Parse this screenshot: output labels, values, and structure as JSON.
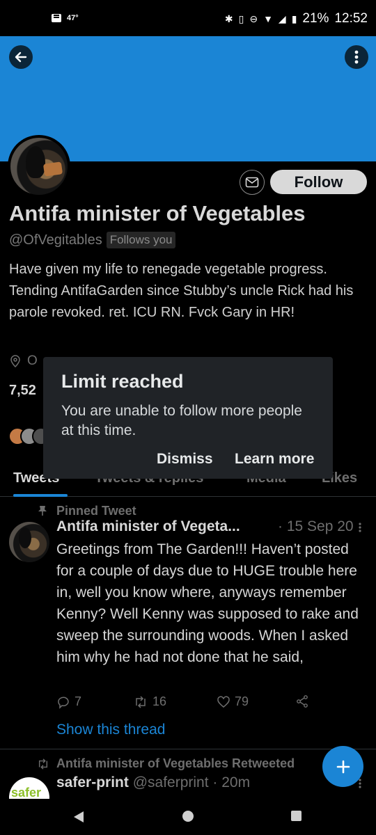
{
  "status_bar": {
    "temperature": "47°",
    "battery": "21%",
    "time": "12:52"
  },
  "profile": {
    "display_name": "Antifa minister of Vegetables",
    "handle": "@OfVegitables",
    "follows_you": "Follows you",
    "bio": "Have given my life to renegade vegetable progress. Tending AntifaGarden since Stubby’s uncle Rick had his parole revoked. ret. ICU RN. Fvck Gary in HR!",
    "meta_visible": "O",
    "count_visible": "7,52",
    "follow_label": "Follow"
  },
  "dialog": {
    "title": "Limit reached",
    "message": "You are unable to follow more people at this time.",
    "dismiss": "Dismiss",
    "learn_more": "Learn more"
  },
  "tabs": [
    {
      "label": "Tweets",
      "active": true
    },
    {
      "label": "Tweets & replies",
      "active": false
    },
    {
      "label": "Media",
      "active": false
    },
    {
      "label": "Likes",
      "active": false
    }
  ],
  "pinned_tweet": {
    "label": "Pinned Tweet",
    "author": "Antifa minister of Vegeta...",
    "date": "· 15 Sep 20",
    "text": "Greetings from The Garden!!! Haven’t posted for a couple of days due to HUGE trouble here in, well you know where, anyways remember Kenny? Well Kenny was supposed to rake and sweep the surrounding woods. When I asked him why he had not done that he said,",
    "replies": "7",
    "retweets": "16",
    "likes": "79",
    "show_thread": "Show this thread"
  },
  "retweet": {
    "label": "Antifa minister of Vegetables Retweeted",
    "author": "safer-print",
    "handle": "@saferprint · 20m",
    "avatar_text": "safer"
  },
  "colors": {
    "accent": "#1b85d5",
    "background": "#000000",
    "dialog": "#202327"
  }
}
